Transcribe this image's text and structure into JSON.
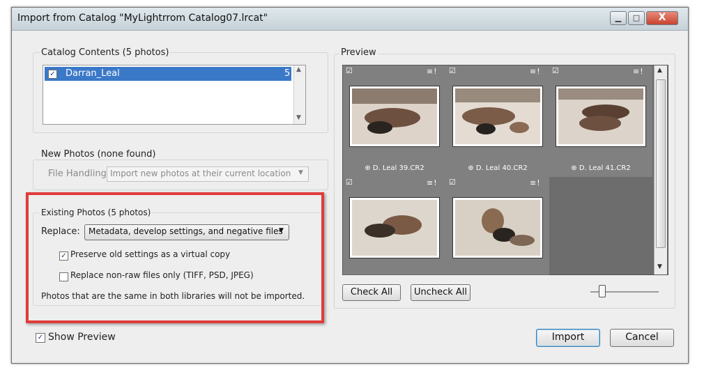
{
  "window": {
    "title": "Import from Catalog \"MyLightrrom Catalog07.lrcat\"",
    "min_glyph": "▁",
    "max_glyph": "□",
    "close_glyph": "X"
  },
  "catalog_contents": {
    "label": "Catalog Contents (5 photos)",
    "items": [
      {
        "name": "Darran_Leal",
        "count": "5",
        "checked": true
      }
    ]
  },
  "new_photos": {
    "label": "New Photos (none found)",
    "file_handling_label": "File Handling:",
    "file_handling_value": "Import new photos at their current location"
  },
  "existing_photos": {
    "label": "Existing Photos (5 photos)",
    "replace_label": "Replace:",
    "replace_value": "Metadata, develop settings, and negative files",
    "preserve_label": "Preserve old settings as a virtual copy",
    "preserve_checked": true,
    "nonraw_label": "Replace non-raw files only (TIFF, PSD, JPEG)",
    "nonraw_checked": false,
    "note": "Photos that are the same in both libraries will not be imported."
  },
  "preview": {
    "label": "Preview",
    "photos": [
      {
        "filename": "D. Leal 39.CR2",
        "checked": true
      },
      {
        "filename": "D. Leal 40.CR2",
        "checked": true
      },
      {
        "filename": "D. Leal 41.CR2",
        "checked": true
      },
      {
        "filename": "",
        "checked": true
      },
      {
        "filename": "",
        "checked": true
      }
    ],
    "check_all": "Check All",
    "uncheck_all": "Uncheck All"
  },
  "footer": {
    "show_preview_label": "Show Preview",
    "show_preview_checked": true,
    "import_label": "Import",
    "cancel_label": "Cancel"
  },
  "colors": {
    "selection": "#3a78c8",
    "highlight_box": "#e03c3c",
    "grid_cell": "#808080"
  }
}
